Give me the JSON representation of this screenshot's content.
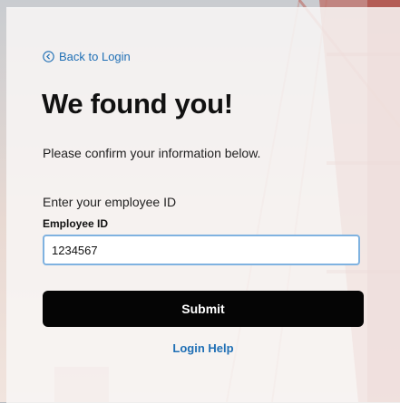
{
  "back_link": {
    "label": "Back to Login",
    "icon": "chevron-left-circle-icon"
  },
  "title": "We found you!",
  "subtitle": "Please confirm your information below.",
  "prompt": "Enter your employee ID",
  "employee_id": {
    "label": "Employee ID",
    "value": "1234567",
    "placeholder": ""
  },
  "submit_label": "Submit",
  "help_label": "Login Help",
  "colors": {
    "link": "#1f6fb5",
    "button": "#050505",
    "input_border": "#7fb2e0",
    "bridge": "#c0433a"
  }
}
